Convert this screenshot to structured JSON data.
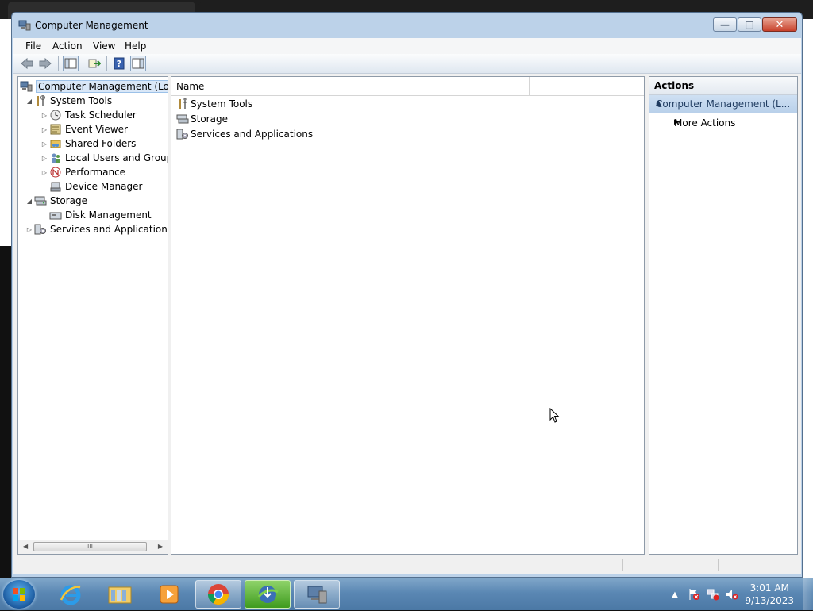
{
  "window": {
    "title": "Computer Management",
    "minimize_glyph": "—",
    "maximize_glyph": "□",
    "close_glyph": "✕"
  },
  "menu": [
    "File",
    "Action",
    "View",
    "Help"
  ],
  "tree": {
    "root": "Computer Management (Local",
    "items": [
      {
        "label": "System Tools",
        "expander": "◢"
      },
      {
        "label": "Task Scheduler",
        "expander": "▷"
      },
      {
        "label": "Event Viewer",
        "expander": "▷"
      },
      {
        "label": "Shared Folders",
        "expander": "▷"
      },
      {
        "label": "Local Users and Groups",
        "expander": "▷"
      },
      {
        "label": "Performance",
        "expander": "▷"
      },
      {
        "label": "Device Manager",
        "expander": ""
      },
      {
        "label": "Storage",
        "expander": "◢"
      },
      {
        "label": "Disk Management",
        "expander": ""
      },
      {
        "label": "Services and Applications",
        "expander": "▷"
      }
    ],
    "scroll_left": "◀",
    "scroll_right": "▶",
    "scroll_grip": "III"
  },
  "list": {
    "column_name": "Name",
    "rows": [
      "System Tools",
      "Storage",
      "Services and Applications"
    ]
  },
  "actions": {
    "header": "Actions",
    "section": "Computer Management (L...",
    "section_arrow": "▲",
    "more_actions": "More Actions",
    "more_arrow": "▶"
  },
  "taskbar": {
    "time": "3:01 AM",
    "date": "9/13/2023",
    "tray_arrow": "▲"
  },
  "colors": {
    "window_frame": "#bcd2e9",
    "taskbar": "#5a87b3",
    "selection": "#d9e7f7"
  }
}
